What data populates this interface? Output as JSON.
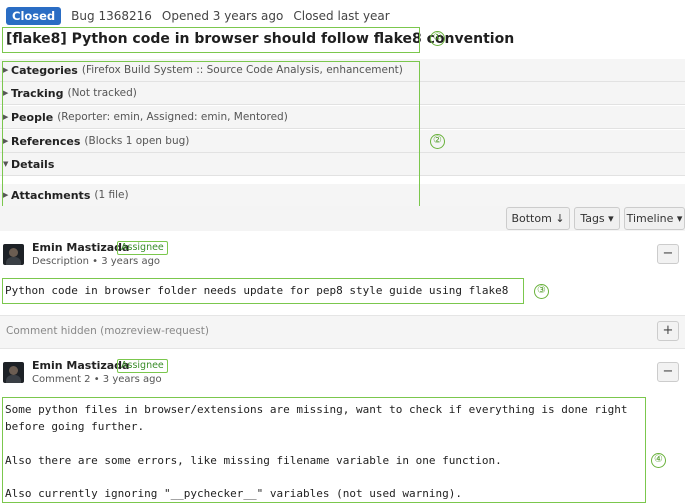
{
  "header": {
    "status": "Closed",
    "bug_id": "Bug 1368216",
    "opened": "Opened 3 years ago",
    "closed": "Closed last year"
  },
  "title": "[flake8] Python code in browser should follow flake8 convention",
  "sections": [
    {
      "label": "Categories",
      "summary": "(Firefox Build System :: Source Code Analysis, enhancement)"
    },
    {
      "label": "Tracking",
      "summary": "(Not tracked)"
    },
    {
      "label": "People",
      "summary": "(Reporter: emin, Assigned: emin, Mentored)"
    },
    {
      "label": "References",
      "summary": "(Blocks 1 open bug)"
    },
    {
      "label": "Details",
      "summary": ""
    },
    {
      "label": "Attachments",
      "summary": "(1 file)"
    }
  ],
  "toolbar": {
    "bottom_label": "Bottom ↓",
    "tags_label": "Tags ▾",
    "timeline_label": "Timeline ▾"
  },
  "comments": [
    {
      "author": "Emin Mastizada",
      "role": "Assignee",
      "meta": "Description • 3 years ago",
      "toggle": "−",
      "text": "Python code in browser folder needs update for pep8 style guide using flake8"
    },
    {
      "author": "Emin Mastizada",
      "role": "Assignee",
      "meta": "Comment 2 • 3 years ago",
      "toggle": "−",
      "text_lines": [
        "Some python files in browser/extensions are missing, want to check if everything is done right",
        "before going further.",
        "",
        "Also there are some errors, like missing filename variable in one function.",
        "",
        "Also currently ignoring \"__pychecker__\" variables (not used warning)."
      ]
    }
  ],
  "hidden_comment": {
    "text": "Comment hidden (mozreview-request)",
    "toggle": "+"
  },
  "annotations": [
    "①",
    "②",
    "③",
    "④"
  ],
  "colors": {
    "status_badge": "#2a6dc4",
    "annotation_green": "#7bc74d"
  }
}
